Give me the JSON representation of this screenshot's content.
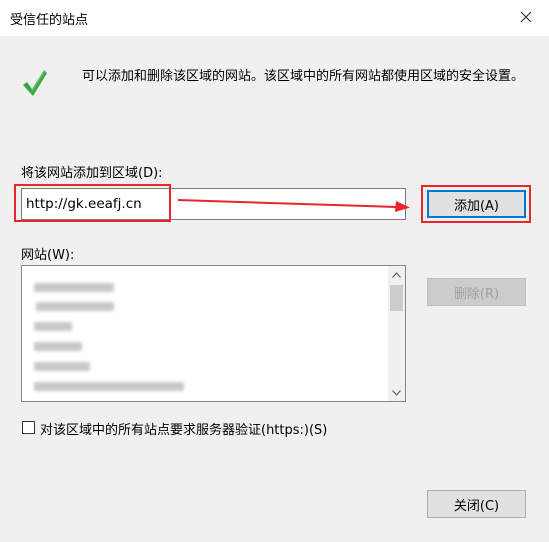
{
  "window": {
    "title": "受信任的站点",
    "close_label": "✕"
  },
  "info": {
    "text": "可以添加和删除该区域的网站。该区域中的所有网站都使用区域的安全设置。"
  },
  "add_section": {
    "label": "将该网站添加到区域(D):",
    "url_value": "http://gk.eeafj.cn",
    "add_button": "添加(A)"
  },
  "sites_section": {
    "label": "网站(W):",
    "remove_button": "删除(R)"
  },
  "https_check": {
    "label": "对该区域中的所有站点要求服务器验证(https:)(S)",
    "checked": false
  },
  "footer": {
    "close_button": "关闭(C)"
  },
  "colors": {
    "highlight": "#e8262b",
    "check_green": "#3aa845"
  }
}
